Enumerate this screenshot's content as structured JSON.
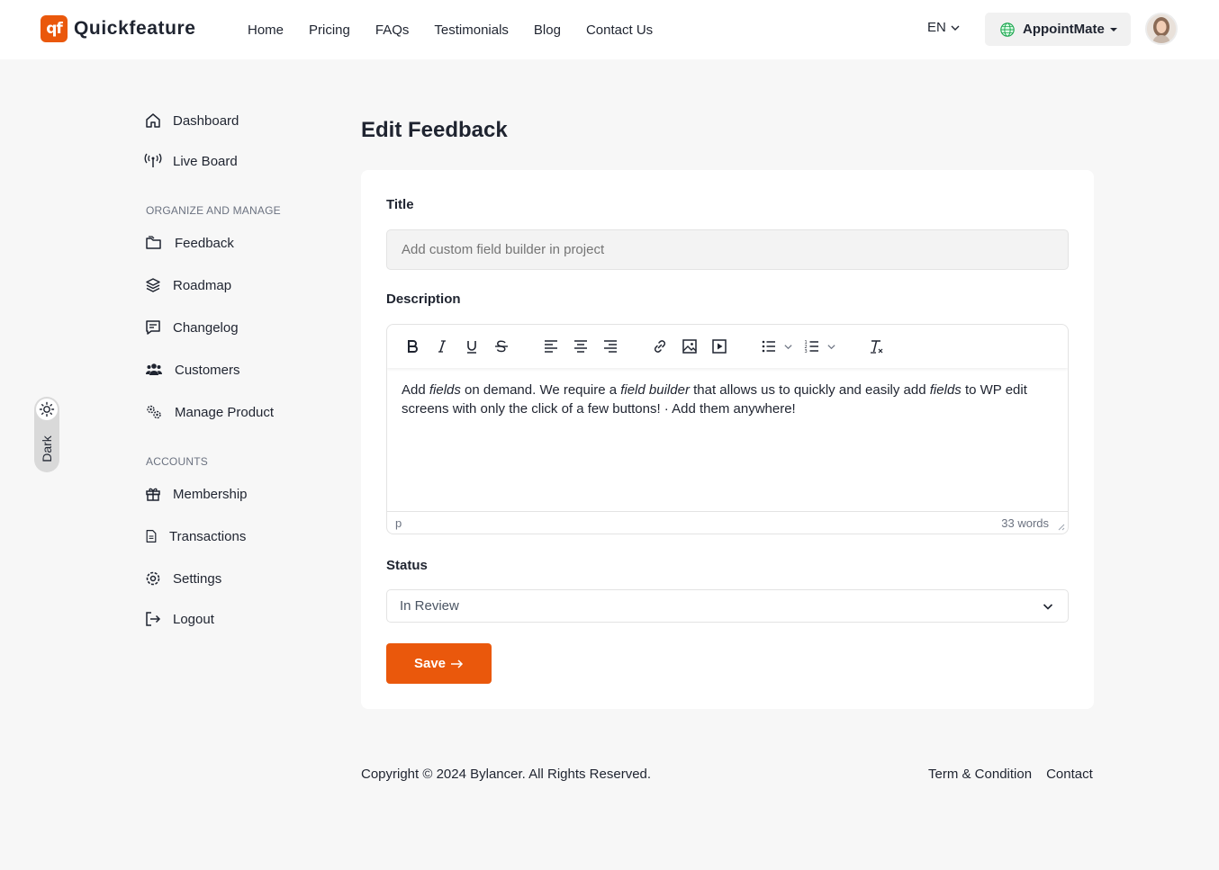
{
  "brand": {
    "logo_mark": "qf",
    "name": "Quickfeature",
    "accent": "#ea580c"
  },
  "nav": {
    "items": [
      {
        "label": "Home"
      },
      {
        "label": "Pricing"
      },
      {
        "label": "FAQs"
      },
      {
        "label": "Testimonials"
      },
      {
        "label": "Blog"
      },
      {
        "label": "Contact Us"
      }
    ]
  },
  "header": {
    "language": "EN",
    "workspace": "AppointMate"
  },
  "theme_toggle": {
    "label": "Dark",
    "icon": "sun-icon"
  },
  "sidebar": {
    "top_items": [
      {
        "label": "Dashboard",
        "icon": "home-icon"
      },
      {
        "label": "Live Board",
        "icon": "broadcast-icon"
      }
    ],
    "sections": [
      {
        "heading": "ORGANIZE AND MANAGE",
        "items": [
          {
            "label": "Feedback",
            "icon": "folder-icon"
          },
          {
            "label": "Roadmap",
            "icon": "layers-icon"
          },
          {
            "label": "Changelog",
            "icon": "message-icon"
          },
          {
            "label": "Customers",
            "icon": "users-icon"
          },
          {
            "label": "Manage Product",
            "icon": "gears-icon"
          }
        ]
      },
      {
        "heading": "ACCOUNTS",
        "items": [
          {
            "label": "Membership",
            "icon": "gift-icon"
          },
          {
            "label": "Transactions",
            "icon": "file-icon"
          },
          {
            "label": "Settings",
            "icon": "gear-icon"
          },
          {
            "label": "Logout",
            "icon": "logout-icon"
          }
        ]
      }
    ]
  },
  "main": {
    "page_title": "Edit Feedback",
    "title_label": "Title",
    "title_placeholder": "Add custom field builder in project",
    "description_label": "Description",
    "editor": {
      "toolbar": [
        "bold",
        "italic",
        "underline",
        "strikethrough",
        "align-left",
        "align-center",
        "align-right",
        "link",
        "image",
        "media",
        "bullet-list",
        "numbered-list",
        "clear-formatting"
      ],
      "content": {
        "p1": "Add ",
        "em1": "fields",
        "p2": " on demand. We require a ",
        "em2": "field builder",
        "p3": " that allows us to quickly and easily add ",
        "em3": "fields",
        "p4": " to WP edit screens with only the click of a few buttons! · Add them anywhere!"
      },
      "path": "p",
      "word_count": "33 words"
    },
    "status_label": "Status",
    "status_value": "In Review",
    "save_label": "Save"
  },
  "footer": {
    "copyright": "Copyright © 2024 Bylancer. All Rights Reserved.",
    "links": [
      {
        "label": "Term & Condition"
      },
      {
        "label": "Contact"
      }
    ]
  }
}
